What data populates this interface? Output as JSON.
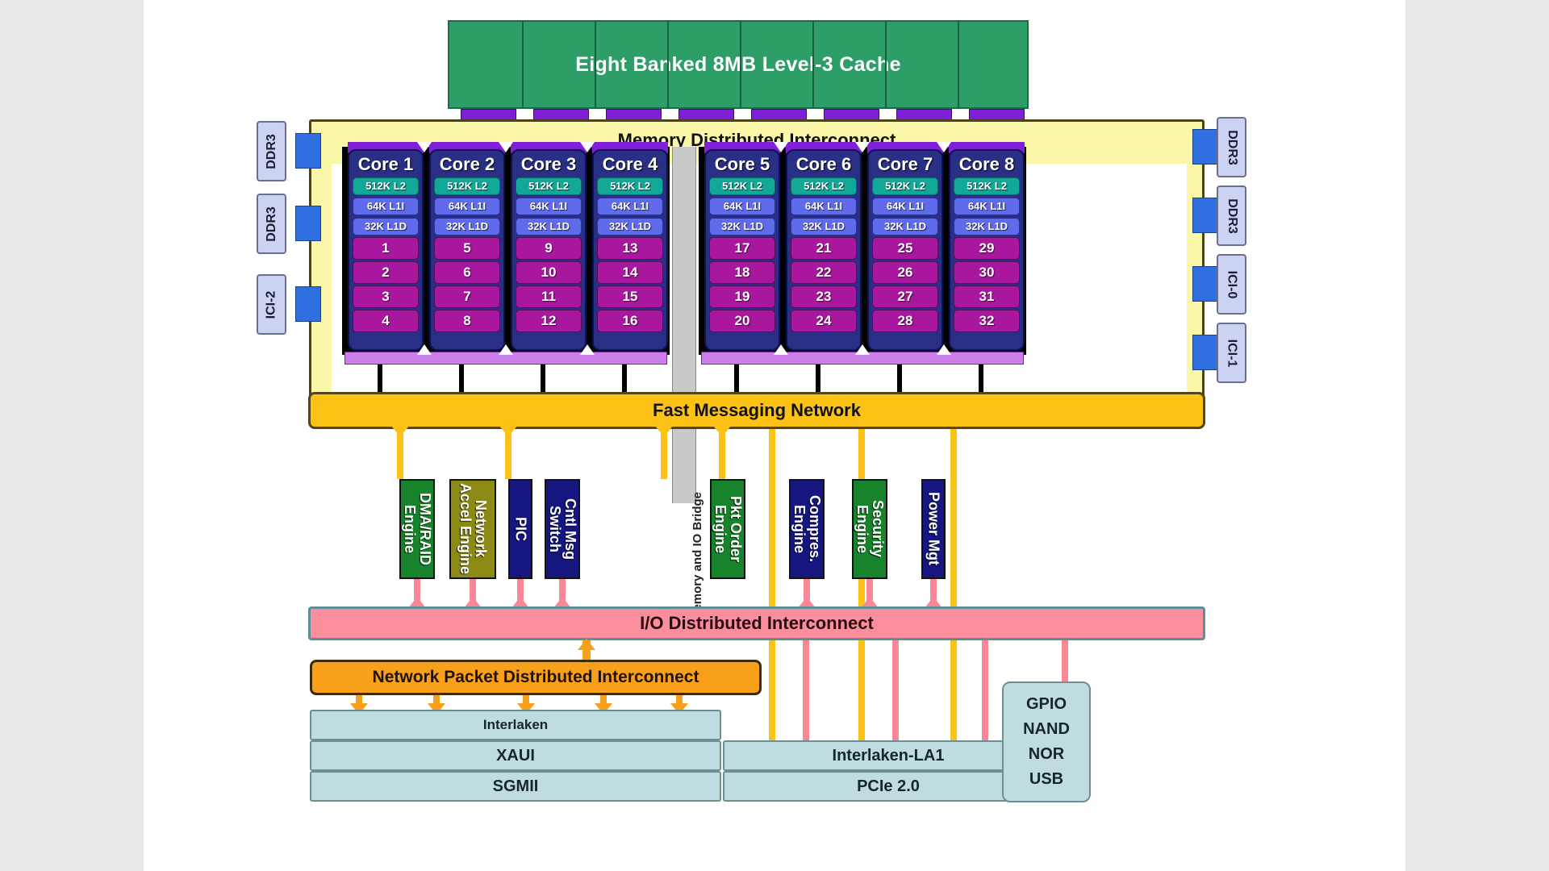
{
  "diagram": {
    "title": "Eight Banked 8MB Level-3 Cache",
    "l3_cache": {
      "label": "Eight Banked 8MB Level-3 Cache",
      "banks": 8,
      "color": "#2e9e69"
    },
    "memory_interconnect": {
      "label": "Memory Distributed Interconnect",
      "color": "#fbf7a8"
    },
    "bridge": {
      "label": "Memory and IO Bridge",
      "color": "#c9c9c9"
    },
    "fast_messaging_network": {
      "label": "Fast Messaging Network",
      "color": "#fcc316"
    },
    "io_interconnect": {
      "label": "I/O Distributed Interconnect",
      "color": "#fb8e9c"
    },
    "network_packet_interconnect": {
      "label": "Network Packet Distributed Interconnect",
      "color": "#f9a01b"
    },
    "cores": [
      {
        "name": "Core 1",
        "l2": "512K L2",
        "l1i": "64K L1I",
        "l1d": "32K L1D",
        "threads": [
          "1",
          "2",
          "3",
          "4"
        ]
      },
      {
        "name": "Core 2",
        "l2": "512K L2",
        "l1i": "64K L1I",
        "l1d": "32K L1D",
        "threads": [
          "5",
          "6",
          "7",
          "8"
        ]
      },
      {
        "name": "Core 3",
        "l2": "512K L2",
        "l1i": "64K L1I",
        "l1d": "32K L1D",
        "threads": [
          "9",
          "10",
          "11",
          "12"
        ]
      },
      {
        "name": "Core 4",
        "l2": "512K L2",
        "l1i": "64K L1I",
        "l1d": "32K L1D",
        "threads": [
          "13",
          "14",
          "15",
          "16"
        ]
      },
      {
        "name": "Core 5",
        "l2": "512K L2",
        "l1i": "64K L1I",
        "l1d": "32K L1D",
        "threads": [
          "17",
          "18",
          "19",
          "20"
        ]
      },
      {
        "name": "Core 6",
        "l2": "512K L2",
        "l1i": "64K L1I",
        "l1d": "32K L1D",
        "threads": [
          "21",
          "22",
          "23",
          "24"
        ]
      },
      {
        "name": "Core 7",
        "l2": "512K L2",
        "l1i": "64K L1I",
        "l1d": "32K L1D",
        "threads": [
          "25",
          "26",
          "27",
          "28"
        ]
      },
      {
        "name": "Core 8",
        "l2": "512K L2",
        "l1i": "64K L1I",
        "l1d": "32K L1D",
        "threads": [
          "29",
          "30",
          "31",
          "32"
        ]
      }
    ],
    "left_ports": [
      {
        "label": "DDR3"
      },
      {
        "label": "DDR3"
      },
      {
        "label": "ICI-2"
      }
    ],
    "right_ports": [
      {
        "label": "DDR3"
      },
      {
        "label": "DDR3"
      },
      {
        "label": "ICI-0"
      },
      {
        "label": "ICI-1"
      }
    ],
    "engines": [
      {
        "label": "DMA/RAID Engine",
        "line1": "DMA/RAID",
        "line2": "Engine",
        "color": "green"
      },
      {
        "label": "Network Accel Engine",
        "line1": "Network",
        "line2": "Accel Engine",
        "color": "olive"
      },
      {
        "label": "PIC",
        "line1": "PIC",
        "line2": "",
        "color": "navy"
      },
      {
        "label": "Cntl Msg Switch",
        "line1": "Cntl Msg",
        "line2": "Switch",
        "color": "navy"
      },
      {
        "label": "Pkt Order Engine",
        "line1": "Pkt Order",
        "line2": "Engine",
        "color": "green"
      },
      {
        "label": "Compres. Engine",
        "line1": "Compres.",
        "line2": "Engine",
        "color": "navy"
      },
      {
        "label": "Security Engine",
        "line1": "Security",
        "line2": "Engine",
        "color": "green"
      },
      {
        "label": "Power Mgt",
        "line1": "Power Mgt",
        "line2": "",
        "color": "navy"
      }
    ],
    "io_left_stack": [
      {
        "label": "Interlaken"
      },
      {
        "label": "XAUI"
      },
      {
        "label": "SGMII"
      }
    ],
    "io_right_stack": [
      {
        "label": "Interlaken-LA1"
      },
      {
        "label": "PCIe 2.0"
      }
    ],
    "gpio_block": {
      "lines": [
        "GPIO",
        "NAND",
        "NOR",
        "USB"
      ]
    }
  }
}
